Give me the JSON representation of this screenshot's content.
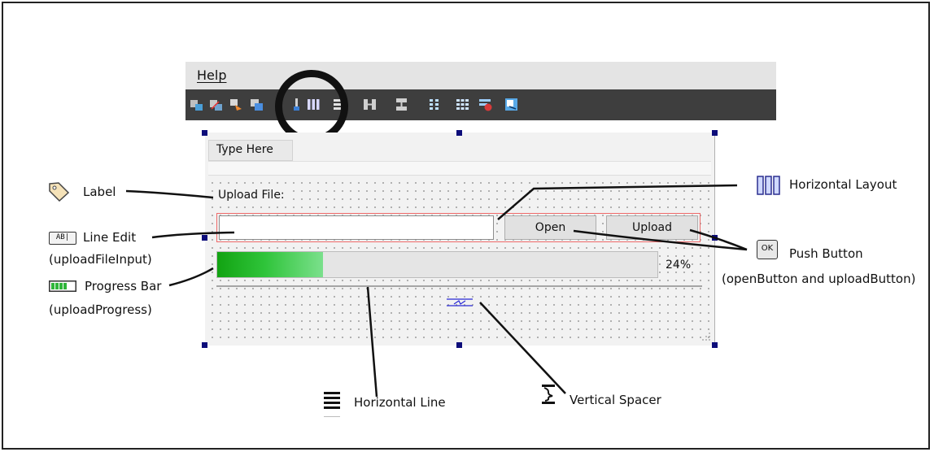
{
  "menubar": {
    "help_label": "Help"
  },
  "toolbar": {
    "icons": [
      "edit-widgets-icon",
      "edit-signals-slots-icon",
      "edit-buddies-icon",
      "edit-tab-order-icon",
      "layout-horizontal-icon",
      "layout-vertical-icon",
      "horizontal-splitter-icon",
      "vertical-splitter-icon",
      "layout-form-icon",
      "layout-grid-icon",
      "break-layout-icon",
      "adjust-size-icon"
    ]
  },
  "form": {
    "menu_placeholder": "Type Here",
    "upload_label": "Upload File:",
    "upload_input_value": "",
    "open_button": "Open",
    "upload_button": "Upload",
    "progress": {
      "percent": 24,
      "text": "24%"
    }
  },
  "annotations": {
    "label": "Label",
    "line_edit": "Line Edit",
    "line_edit_name": "(uploadFileInput)",
    "progress_bar": "Progress Bar",
    "progress_bar_name": "(uploadProgress)",
    "horizontal_layout": "Horizontal Layout",
    "push_button": "Push Button",
    "push_button_names": "(openButton and uploadButton)",
    "horizontal_line": "Horizontal Line",
    "vertical_spacer": "Vertical Spacer",
    "ok_icon_text": "OK",
    "lineedit_icon_text": "AB|"
  },
  "colors": {
    "toolbar_bg": "#3e3e3e",
    "layout_outline": "#ee6a6a",
    "progress_green": "#2fc43a",
    "handle": "#0d0d7a"
  }
}
